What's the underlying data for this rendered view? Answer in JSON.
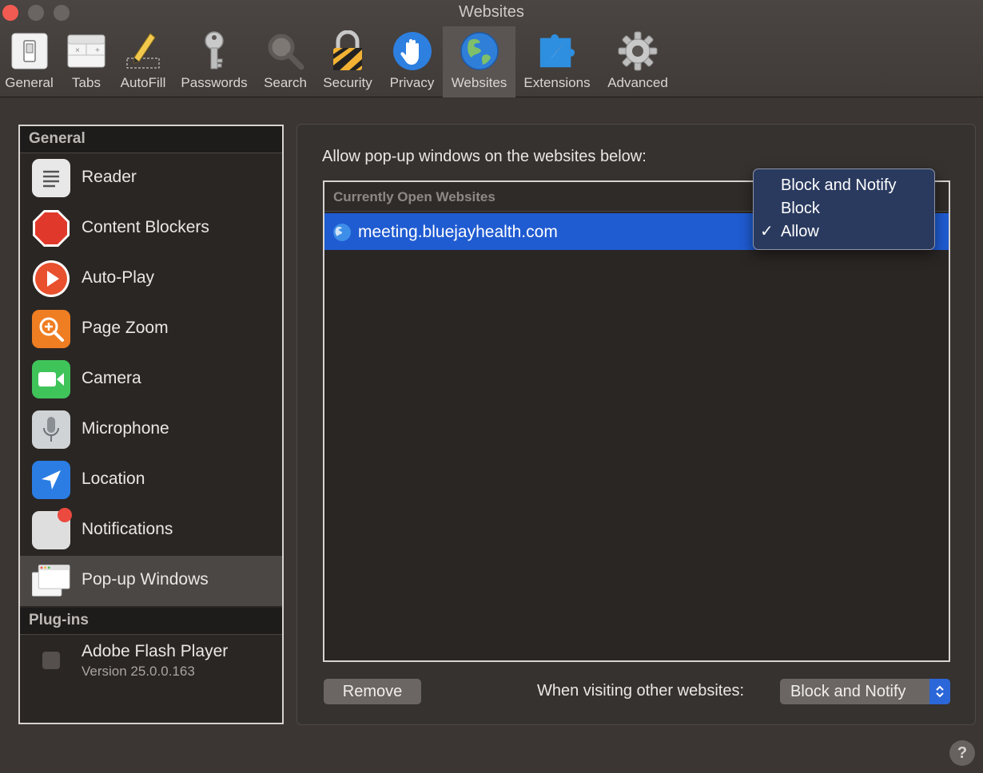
{
  "window": {
    "title": "Websites"
  },
  "toolbar": {
    "items": [
      {
        "label": "General",
        "icon": "general-switch-icon"
      },
      {
        "label": "Tabs",
        "icon": "tabs-icon"
      },
      {
        "label": "AutoFill",
        "icon": "autofill-pencil-icon"
      },
      {
        "label": "Passwords",
        "icon": "key-icon"
      },
      {
        "label": "Search",
        "icon": "magnifier-icon"
      },
      {
        "label": "Security",
        "icon": "padlock-icon"
      },
      {
        "label": "Privacy",
        "icon": "hand-icon"
      },
      {
        "label": "Websites",
        "icon": "globe-icon",
        "active": true
      },
      {
        "label": "Extensions",
        "icon": "puzzle-compass-icon"
      },
      {
        "label": "Advanced",
        "icon": "gear-icon"
      }
    ]
  },
  "sidebar": {
    "general_header": "General",
    "items": [
      {
        "label": "Reader",
        "icon": "reader-icon"
      },
      {
        "label": "Content Blockers",
        "icon": "stop-octagon-icon"
      },
      {
        "label": "Auto-Play",
        "icon": "play-icon"
      },
      {
        "label": "Page Zoom",
        "icon": "zoom-icon"
      },
      {
        "label": "Camera",
        "icon": "camera-icon"
      },
      {
        "label": "Microphone",
        "icon": "microphone-icon"
      },
      {
        "label": "Location",
        "icon": "location-arrow-icon"
      },
      {
        "label": "Notifications",
        "icon": "notifications-icon"
      },
      {
        "label": "Pop-up Windows",
        "icon": "popup-windows-icon",
        "selected": true
      }
    ],
    "plugins_header": "Plug-ins",
    "plugin": {
      "name": "Adobe Flash Player",
      "version": "Version 25.0.0.163"
    }
  },
  "main": {
    "caption": "Allow pop-up windows on the websites below:",
    "list_header": "Currently Open Websites",
    "rows": [
      {
        "site": "meeting.bluejayhealth.com"
      }
    ],
    "remove_label": "Remove",
    "visiting_label": "When visiting other websites:",
    "visiting_value": "Block and Notify"
  },
  "dropdown": {
    "options": [
      "Block and Notify",
      "Block",
      "Allow"
    ],
    "checked": "Allow",
    "check_mark": "✓"
  },
  "help": {
    "label": "?"
  },
  "colors": {
    "accent": "#1f5bd1",
    "close_button": "#f25b52"
  }
}
